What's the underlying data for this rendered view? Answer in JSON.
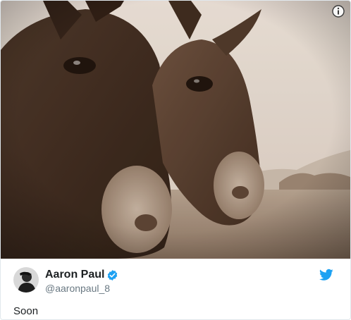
{
  "tweet": {
    "author": {
      "display_name": "Aaron Paul",
      "handle": "@aaronpaul_8",
      "verified": true
    },
    "text": "Soon",
    "media": {
      "description": "Two donkeys close-up, sepia tone"
    }
  },
  "icons": {
    "info": "info-icon",
    "verified": "verified-badge-icon",
    "brand": "twitter-bird-icon"
  },
  "colors": {
    "twitter_blue": "#1da1f2",
    "name_text": "#1c2022",
    "handle_text": "#697882"
  }
}
